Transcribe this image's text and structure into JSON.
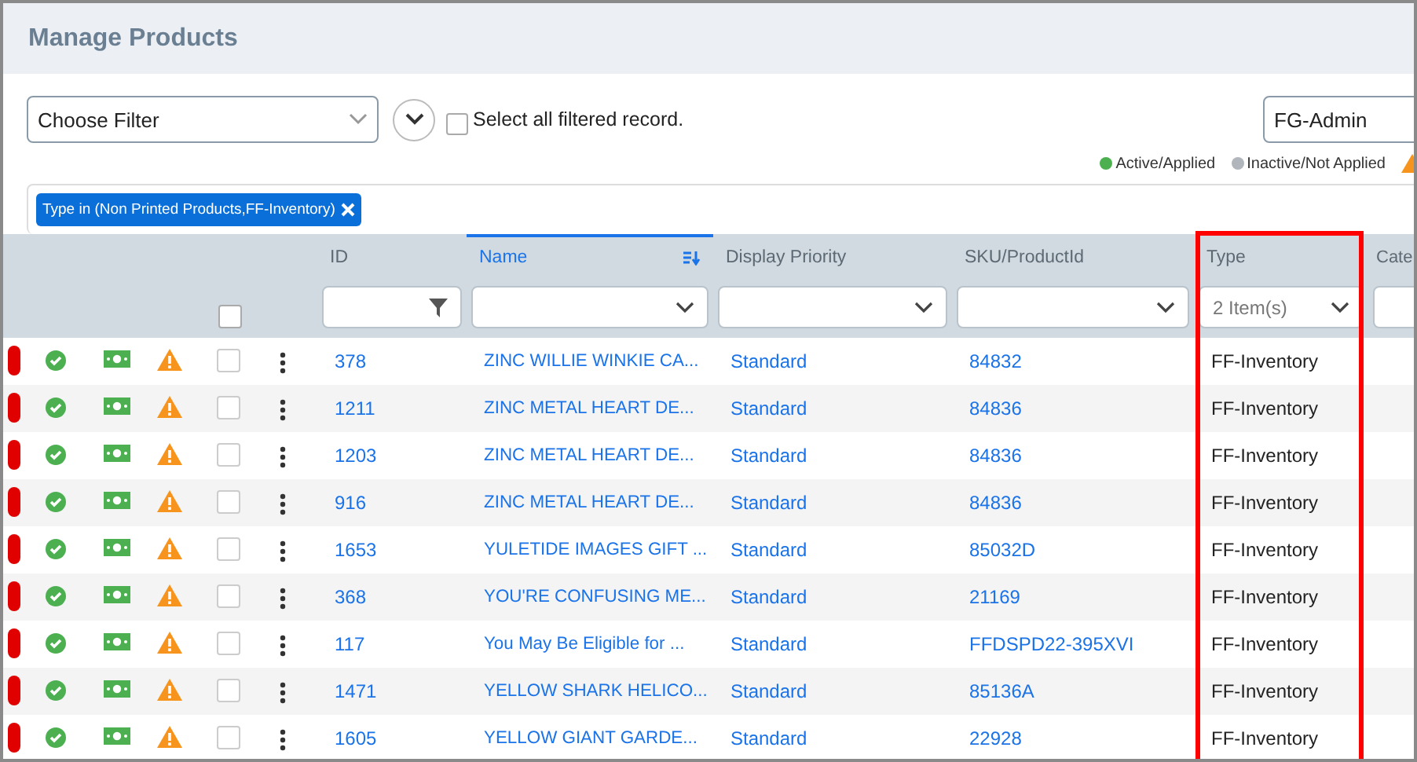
{
  "title": "Manage Products",
  "filter": {
    "placeholder": "Choose Filter"
  },
  "select_all": {
    "label": "Select all filtered record.",
    "checked": false
  },
  "role": {
    "value": "FG-Admin"
  },
  "legend": [
    {
      "label": "Active/Applied",
      "color": "#4caf50"
    },
    {
      "label": "Inactive/Not Applied",
      "color": "#b0b6bb"
    }
  ],
  "chips": [
    {
      "label": "Type in (Non Printed Products,FF-Inventory)"
    }
  ],
  "header_checkbox": {
    "checked": false
  },
  "columns": [
    {
      "label": "ID",
      "kind": "text",
      "sorted": false,
      "highlighted": false
    },
    {
      "label": "Name",
      "kind": "dropdown",
      "sorted": true,
      "highlighted": false
    },
    {
      "label": "Display Priority",
      "kind": "dropdown",
      "sorted": false,
      "highlighted": false
    },
    {
      "label": "SKU/ProductId",
      "kind": "dropdown",
      "sorted": false,
      "highlighted": false
    },
    {
      "label": "Type",
      "kind": "dropdown",
      "value": "2 Item(s)",
      "sorted": false,
      "highlighted": true
    },
    {
      "label": "Cate",
      "sorted": false,
      "highlighted": false
    }
  ],
  "rows": [
    {
      "checked": false,
      "cells": [
        "378",
        "ZINC WILLIE WINKIE CA...",
        "Standard",
        "84832",
        "FF-Inventory"
      ]
    },
    {
      "checked": false,
      "cells": [
        "1211",
        "ZINC METAL HEART DE...",
        "Standard",
        "84836",
        "FF-Inventory"
      ]
    },
    {
      "checked": false,
      "cells": [
        "1203",
        "ZINC METAL HEART DE...",
        "Standard",
        "84836",
        "FF-Inventory"
      ]
    },
    {
      "checked": false,
      "cells": [
        "916",
        "ZINC METAL HEART DE...",
        "Standard",
        "84836",
        "FF-Inventory"
      ]
    },
    {
      "checked": false,
      "cells": [
        "1653",
        "YULETIDE IMAGES GIFT ...",
        "Standard",
        "85032D",
        "FF-Inventory"
      ]
    },
    {
      "checked": false,
      "cells": [
        "368",
        "YOU'RE CONFUSING ME...",
        "Standard",
        "21169",
        "FF-Inventory"
      ]
    },
    {
      "checked": false,
      "cells": [
        "117",
        "You May Be Eligible for ...",
        "Standard",
        "FFDSPD22-395XVI",
        "FF-Inventory"
      ]
    },
    {
      "checked": false,
      "cells": [
        "1471",
        "YELLOW SHARK HELICO...",
        "Standard",
        "85136A",
        "FF-Inventory"
      ]
    },
    {
      "checked": false,
      "cells": [
        "1605",
        "YELLOW GIANT GARDE...",
        "Standard",
        "22928",
        "FF-Inventory"
      ]
    }
  ]
}
